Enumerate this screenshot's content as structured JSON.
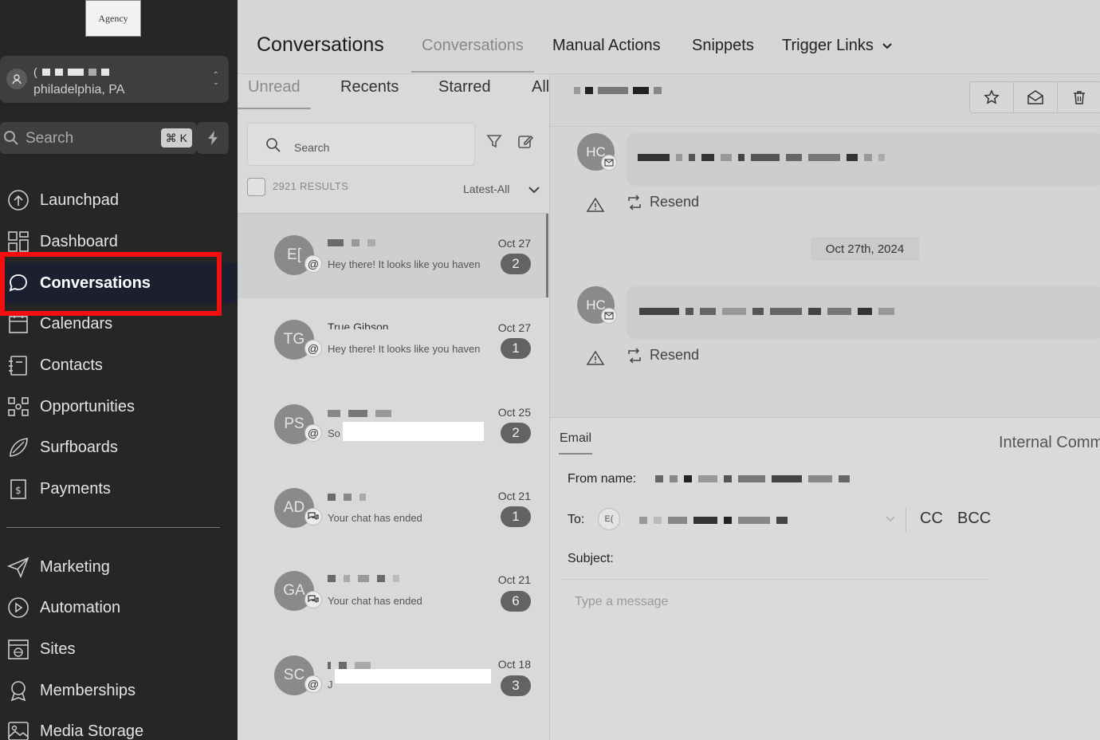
{
  "sidebar": {
    "logo_text": "Agency",
    "location": {
      "city": "philadelphia, PA"
    },
    "search": {
      "placeholder": "Search",
      "shortcut_symbol": "⌘",
      "shortcut_key": "K"
    },
    "nav_main": [
      {
        "label": "Launchpad",
        "icon": "launchpad-icon"
      },
      {
        "label": "Dashboard",
        "icon": "dashboard-grid-icon"
      },
      {
        "label": "Conversations",
        "icon": "chat-bubble-icon",
        "active": true
      },
      {
        "label": "Calendars",
        "icon": "calendar-icon"
      },
      {
        "label": "Contacts",
        "icon": "contacts-book-icon"
      },
      {
        "label": "Opportunities",
        "icon": "opportunities-icon"
      },
      {
        "label": "Surfboards",
        "icon": "surfboard-icon"
      },
      {
        "label": "Payments",
        "icon": "payments-icon"
      }
    ],
    "nav_secondary": [
      {
        "label": "Marketing",
        "icon": "send-icon"
      },
      {
        "label": "Automation",
        "icon": "automation-play-icon"
      },
      {
        "label": "Sites",
        "icon": "globe-window-icon"
      },
      {
        "label": "Memberships",
        "icon": "badge-ribbon-icon"
      },
      {
        "label": "Media Storage",
        "icon": "image-icon"
      }
    ],
    "highlight_color": "#f20f0f"
  },
  "header": {
    "title": "Conversations",
    "tabs": [
      {
        "label": "Conversations",
        "active": true
      },
      {
        "label": "Manual Actions"
      },
      {
        "label": "Snippets"
      },
      {
        "label": "Trigger Links",
        "has_dropdown": true
      }
    ]
  },
  "list": {
    "subtabs": [
      {
        "label": "Unread",
        "active": true
      },
      {
        "label": "Recents"
      },
      {
        "label": "Starred"
      },
      {
        "label": "All"
      }
    ],
    "search_placeholder": "Search",
    "results_count": "2921 RESULTS",
    "sort_label": "Latest-All",
    "conversations": [
      {
        "initials": "E[",
        "channel": "email",
        "preview": "Hey there!  It looks like you haven",
        "date": "Oct 27",
        "unread": "2",
        "selected": true
      },
      {
        "initials": "TG",
        "channel": "email",
        "name_partial": "True Gibson",
        "preview": "Hey there!  It looks like you haven",
        "date": "Oct 27",
        "unread": "1"
      },
      {
        "initials": "PS",
        "channel": "email",
        "preview": "So",
        "date": "Oct 25",
        "unread": "2"
      },
      {
        "initials": "AD",
        "channel": "chat",
        "preview": "Your chat has ended",
        "date": "Oct 21",
        "unread": "1"
      },
      {
        "initials": "GA",
        "channel": "chat",
        "preview": "Your chat has ended",
        "date": "Oct 21",
        "unread": "6"
      },
      {
        "initials": "SC",
        "channel": "email",
        "preview": "J",
        "date": "Oct 18",
        "unread": "3"
      }
    ]
  },
  "thread": {
    "actions": [
      {
        "icon": "star-icon"
      },
      {
        "icon": "envelope-open-icon"
      },
      {
        "icon": "trash-icon"
      }
    ],
    "messages": [
      {
        "initials": "HC",
        "status_icon": "warning-icon",
        "resend_label": "Resend"
      },
      {
        "initials": "HC",
        "status_icon": "warning-icon",
        "resend_label": "Resend"
      }
    ],
    "date_divider": "Oct 27th, 2024"
  },
  "composer": {
    "tabs": {
      "email": "Email",
      "internal": "Internal Comm"
    },
    "from_label": "From name:",
    "to_label": "To:",
    "to_chip": "E(",
    "cc_label": "CC",
    "bcc_label": "BCC",
    "subject_label": "Subject:",
    "message_placeholder": "Type a message"
  }
}
